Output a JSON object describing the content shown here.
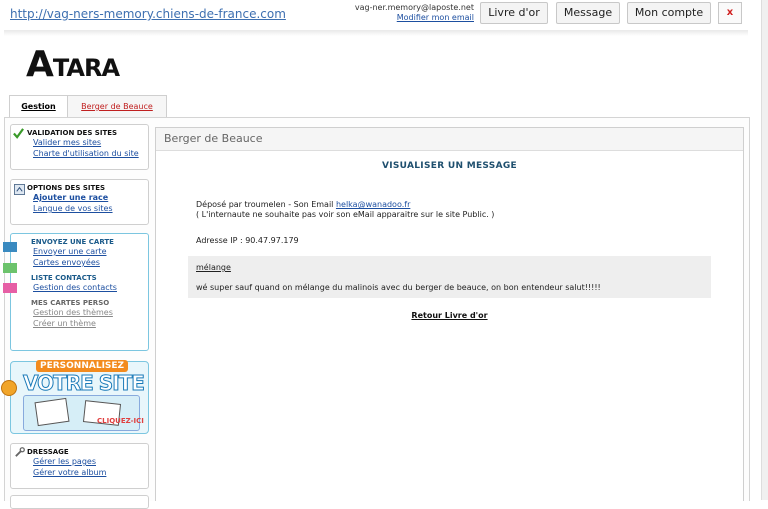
{
  "topbar": {
    "site_url": "http://vag-ners-memory.chiens-de-france.com",
    "email": "vag-ner.memory@laposte.net",
    "modify_email": "Modifier mon email",
    "btn_livre": "Livre d'or",
    "btn_message": "Message",
    "btn_compte": "Mon compte",
    "btn_close": "x"
  },
  "logo": {
    "first": "A",
    "rest": "TARA"
  },
  "tabs": [
    {
      "label": "Gestion"
    },
    {
      "label": "Berger de Beauce"
    }
  ],
  "sidebar": {
    "validation": {
      "title": "Validation des sites",
      "links": [
        "Valider mes sites",
        "Charte d'utilisation du site"
      ]
    },
    "options": {
      "title": "Options des sites",
      "links": [
        "Ajouter une race",
        "Langue de vos sites"
      ]
    },
    "cartes": {
      "title1": "Envoyez une carte",
      "links1": [
        "Envoyer une carte",
        "Cartes envoyées"
      ],
      "title2": "Liste contacts",
      "links2": [
        "Gestion des contacts"
      ],
      "title3": "Mes cartes perso",
      "links3": [
        "Gestion des thèmes",
        "Créer un thème"
      ]
    },
    "promo": {
      "line1": "PERSONNALISEZ",
      "line2": "VOTRE SITE",
      "cta": "CLIQUEZ-ICI"
    },
    "dressage": {
      "title": "Dressage",
      "links": [
        "Gérer les pages",
        "Gérer votre album"
      ]
    }
  },
  "content": {
    "header": "Berger de Beauce",
    "title": "VISUALISER UN MESSAGE",
    "posted_by": "Déposé par troumelen - Son Email",
    "poster_email": "helka@wanadoo.fr",
    "privacy_note": "( L'internaute ne souhaite pas voir son eMail apparaitre sur le site Public. )",
    "ip": "Adresse IP : 90.47.97.179",
    "subject": "mélange",
    "message": "wé super sauf quand on mélange du malinois avec du berger de beauce, on bon entendeur salut!!!!!",
    "back_link": "Retour Livre d'or"
  },
  "colors": {
    "accent": "#1d4fa0",
    "promo_orange": "#f38b1e",
    "promo_blue": "#1a7ab8",
    "close_red": "#d02020"
  }
}
